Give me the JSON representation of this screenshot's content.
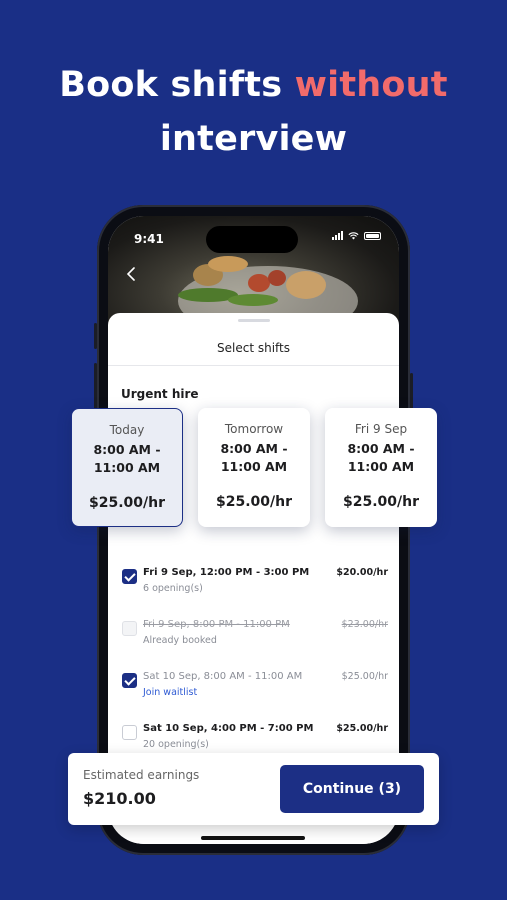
{
  "headline": {
    "part1": "Book shifts ",
    "accent": "without",
    "part2": "interview",
    "accent_color": "#f26b6b"
  },
  "status_bar": {
    "time": "9:41"
  },
  "sheet": {
    "title": "Select shifts",
    "section": "Urgent hire",
    "back_icon": "chevron-left-icon"
  },
  "day_cards": [
    {
      "day": "Today",
      "time_start": "8:00 AM -",
      "time_end": "11:00 AM",
      "rate": "$25.00/hr",
      "selected": true
    },
    {
      "day": "Tomorrow",
      "time_start": "8:00 AM -",
      "time_end": "11:00 AM",
      "rate": "$25.00/hr",
      "selected": false
    },
    {
      "day": "Fri 9 Sep",
      "time_start": "8:00 AM -",
      "time_end": "11:00 AM",
      "rate": "$25.00/hr",
      "selected": false
    }
  ],
  "shifts": [
    {
      "title": "Fri 9 Sep, 12:00 PM - 3:00 PM",
      "sub": "6 opening(s)",
      "price": "$20.00/hr",
      "state": "checked"
    },
    {
      "title": "Fri 9 Sep, 8:00 PM - 11:00 PM",
      "sub": "Already booked",
      "price": "$23.00/hr",
      "state": "booked"
    },
    {
      "title": "Sat 10 Sep, 8:00 AM - 11:00 AM",
      "sub": "Join waitlist",
      "price": "$25.00/hr",
      "state": "waitlist"
    },
    {
      "title": "Sat 10 Sep, 4:00 PM - 7:00 PM",
      "sub": "20 opening(s)",
      "price": "$25.00/hr",
      "state": "unchecked"
    }
  ],
  "footer": {
    "estimate_label": "Estimated earnings",
    "estimate_value": "$210.00",
    "continue_label": "Continue (3)"
  },
  "colors": {
    "background": "#1a2f86",
    "primary": "#1c2f85",
    "link": "#2f5bd3"
  }
}
